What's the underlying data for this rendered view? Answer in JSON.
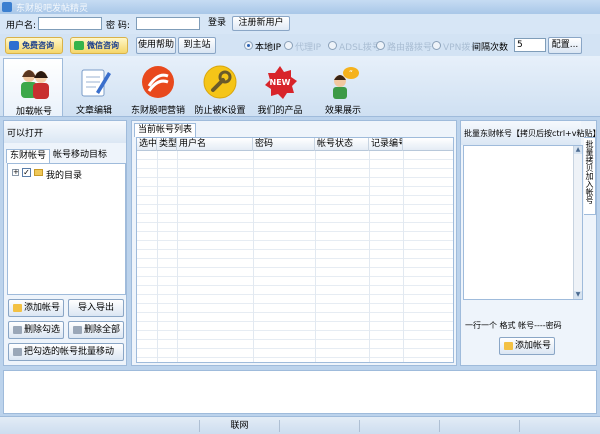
{
  "window": {
    "title": "东财股吧发帖精灵"
  },
  "login": {
    "username_label": "用户名:",
    "username_value": "",
    "password_label": "密  码:",
    "password_value": "",
    "login_button": "登录",
    "register_button": "注册新用户"
  },
  "options": {
    "free_consult": "免费咨询",
    "wechat_consult": "微信咨询",
    "help": "使用帮助",
    "go_site": "到主站",
    "ip_modes": [
      "本地IP",
      "代理IP",
      "ADSL拨号",
      "路由器拨号",
      "VPN拨号"
    ],
    "selected_ip_mode": "本地IP",
    "interval_label": "间隔次数",
    "interval_value": "5",
    "config_button": "配置..."
  },
  "toolbar": {
    "items": [
      {
        "label": "加载帐号",
        "icon": "users-icon",
        "active": true
      },
      {
        "label": "文章编辑",
        "icon": "document-edit-icon",
        "active": false
      },
      {
        "label": "东财股吧营销",
        "icon": "eastmoney-logo-icon",
        "active": false
      },
      {
        "label": "防止被K设置",
        "icon": "wrench-icon",
        "active": false
      },
      {
        "label": "我们的产品",
        "icon": "new-badge-icon",
        "active": false
      },
      {
        "label": "效果展示",
        "icon": "person-quote-icon",
        "active": false
      }
    ]
  },
  "left_panel": {
    "heading": "可以打开",
    "tabs": [
      "东财帐号",
      "帐号移动目标"
    ],
    "tree_root": "我的目录",
    "buttons": {
      "add_account": "添加帐号",
      "import_export": "导入导出",
      "delete_checked": "删除勾选",
      "delete_all": "删除全部",
      "batch_move": "把勾选的帐号批量移动"
    }
  },
  "center_panel": {
    "tab": "当前帐号列表",
    "columns": [
      "选中",
      "类型",
      "用户名",
      "密码",
      "帐号状态",
      "记录编号"
    ],
    "rows": []
  },
  "right_panel": {
    "heading": "批量东财帐号【拷贝后按ctrl+v粘贴】",
    "side_tab": "批量拷贝加入帐号",
    "format_hint": "一行一个 格式 帐号----密码",
    "add_button": "添加帐号"
  },
  "statusbar": {
    "network": "联网"
  }
}
